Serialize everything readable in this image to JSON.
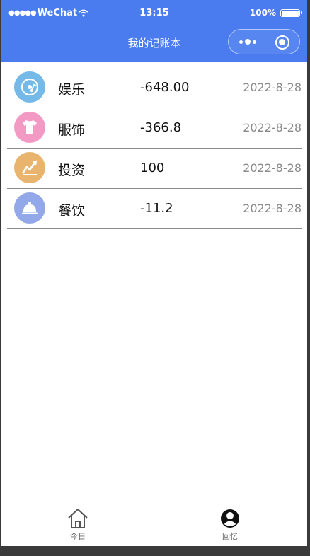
{
  "status_bar": {
    "carrier": "WeChat",
    "time": "13:15",
    "battery": "100%"
  },
  "nav": {
    "title": "我的记账本"
  },
  "records": [
    {
      "category": "娱乐",
      "amount": "-648.00",
      "date": "2022-8-28",
      "icon": "music-disc-icon",
      "color": "#74b9e8"
    },
    {
      "category": "服饰",
      "amount": "-366.8",
      "date": "2022-8-28",
      "icon": "tshirt-icon",
      "color": "#f39ac4"
    },
    {
      "category": "投资",
      "amount": "100",
      "date": "2022-8-28",
      "icon": "trend-chart-icon",
      "color": "#e9b46e"
    },
    {
      "category": "餐饮",
      "amount": "-11.2",
      "date": "2022-8-28",
      "icon": "food-cloche-icon",
      "color": "#92a8e8"
    }
  ],
  "tabbar": {
    "today": "今日",
    "memory": "回忆"
  },
  "colors": {
    "header": "#4a7cf0",
    "divider": "#8c8c8c",
    "date_text": "#8a8a8a"
  }
}
